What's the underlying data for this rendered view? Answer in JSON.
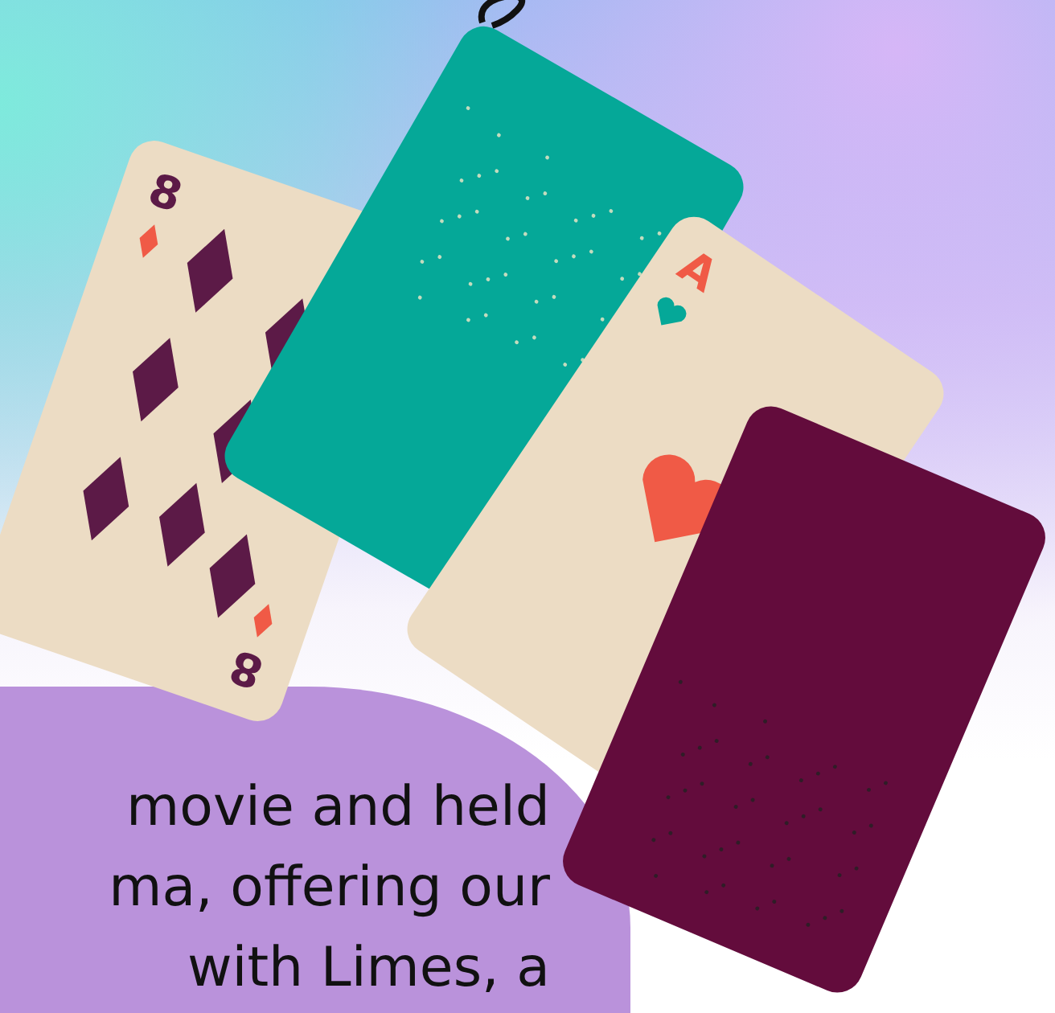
{
  "illustration": {
    "cards": [
      {
        "kind": "diamonds",
        "ranks": [
          "8",
          "8"
        ]
      },
      {
        "kind": "back",
        "color": "#05a898"
      },
      {
        "kind": "hearts",
        "ranks": [
          "A"
        ]
      },
      {
        "kind": "back",
        "color": "#630c3c"
      }
    ]
  },
  "story": {
    "lines": [
      "movie and held",
      "ma, offering our",
      "with  Limes, a"
    ]
  }
}
